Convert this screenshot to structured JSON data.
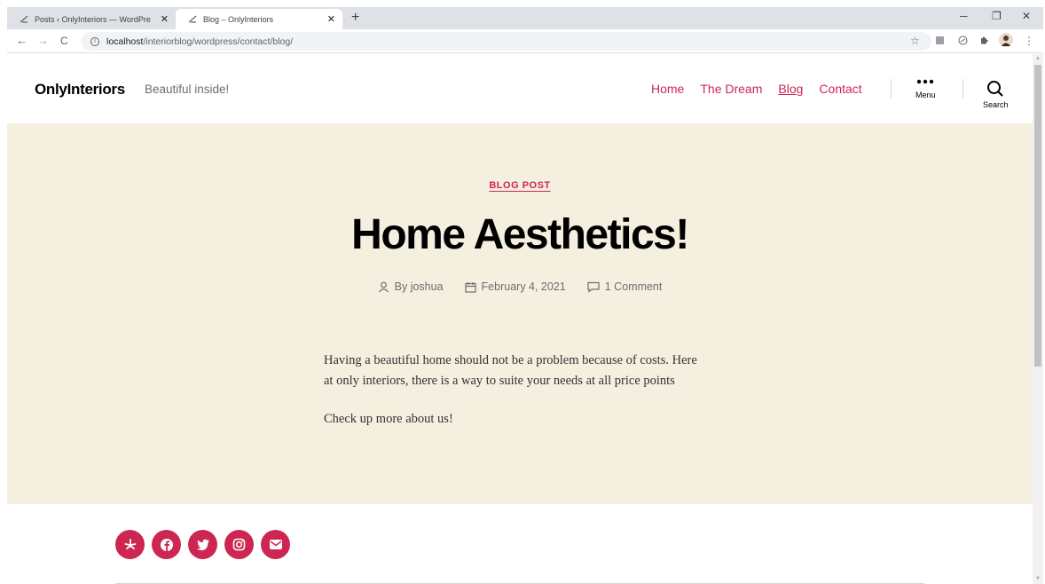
{
  "browser": {
    "tabs": [
      {
        "title": "Posts ‹ OnlyInteriors — WordPre",
        "active": false,
        "close": "✕"
      },
      {
        "title": "Blog – OnlyInteriors",
        "active": true,
        "close": "✕"
      }
    ],
    "new_tab": "+",
    "window_controls": {
      "minimize": "─",
      "restore": "❐",
      "close": "✕"
    },
    "url_host": "localhost",
    "url_path": "/interiorblog/wordpress/contact/blog/",
    "nav": {
      "back": "←",
      "forward": "→",
      "reload": "C"
    }
  },
  "site": {
    "title": "OnlyInteriors",
    "description": "Beautiful inside!",
    "nav": [
      {
        "label": "Home",
        "current": false
      },
      {
        "label": "The Dream",
        "current": false
      },
      {
        "label": "Blog",
        "current": true
      },
      {
        "label": "Contact",
        "current": false
      }
    ],
    "menu_label": "Menu",
    "search_label": "Search"
  },
  "post": {
    "category": "BLOG POST",
    "title": "Home Aesthetics!",
    "author": "By joshua",
    "date": "February 4, 2021",
    "comments": "1 Comment",
    "paragraphs": [
      "Having a beautiful home should not be a problem because of costs. Here at only interiors, there is a way to suite your needs at all price points",
      "Check up more about us!"
    ]
  },
  "social": [
    "yelp-icon",
    "facebook-icon",
    "twitter-icon",
    "instagram-icon",
    "email-icon"
  ],
  "colors": {
    "accent": "#cd2653",
    "hero_bg": "#f5efe0",
    "text": "#000000",
    "muted": "#6d6d6d"
  }
}
